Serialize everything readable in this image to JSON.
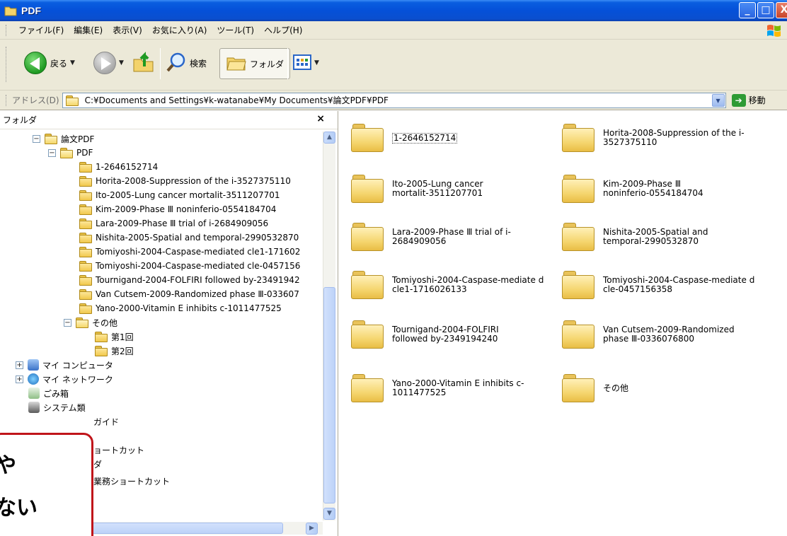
{
  "window": {
    "title": "PDF",
    "icon": "folder-icon"
  },
  "menu": [
    "ファイル(F)",
    "編集(E)",
    "表示(V)",
    "お気に入り(A)",
    "ツール(T)",
    "ヘルプ(H)"
  ],
  "toolbar": {
    "back_label": "戻る",
    "search_label": "検索",
    "folders_label": "フォルダ"
  },
  "address": {
    "label": "アドレス(D)",
    "path": "C:¥Documents and Settings¥k-watanabe¥My Documents¥論文PDF¥PDF",
    "go_label": "移動"
  },
  "folder_pane": {
    "title": "フォルダ",
    "close_glyph": "×",
    "tree": [
      {
        "label": "論文PDF",
        "toggle": "⊟"
      },
      {
        "label": "PDF",
        "toggle": "⊟"
      },
      {
        "label": "1-2646152714"
      },
      {
        "label": "Horita-2008-Suppression of the i-3527375110"
      },
      {
        "label": "Ito-2005-Lung cancer mortalit-3511207701"
      },
      {
        "label": "Kim-2009-Phase Ⅲ noninferio-0554184704"
      },
      {
        "label": "Lara-2009-Phase Ⅲ trial of i-2684909056"
      },
      {
        "label": "Nishita-2005-Spatial and temporal-2990532870"
      },
      {
        "label": "Tomiyoshi-2004-Caspase-mediated cle1-171602"
      },
      {
        "label": "Tomiyoshi-2004-Caspase-mediated cle-0457156"
      },
      {
        "label": "Tournigand-2004-FOLFIRI followed by-23491942"
      },
      {
        "label": "Van Cutsem-2009-Randomized phase Ⅲ-033607"
      },
      {
        "label": "Yano-2000-Vitamin E inhibits c-1011477525"
      },
      {
        "label": "その他",
        "toggle": "⊟"
      },
      {
        "label": "第1回"
      },
      {
        "label": "第2回"
      },
      {
        "label": "マイ コンピュータ",
        "toggle": "⊞"
      },
      {
        "label": "マイ ネットワーク",
        "toggle": "⊞"
      },
      {
        "label": "ごみ箱"
      },
      {
        "label": "システム類"
      },
      {
        "label": "ガイド"
      },
      {
        "label": "ョートカット"
      },
      {
        "label": "ダ"
      },
      {
        "label": "業務ショートカット"
      }
    ]
  },
  "content_items": [
    {
      "label": "1-2646152714",
      "selected": true
    },
    {
      "label": "Horita-2008-Suppression of the i-3527375110"
    },
    {
      "label": "Ito-2005-Lung cancer mortalit-3511207701"
    },
    {
      "label": "Kim-2009-Phase Ⅲ noninferio-0554184704"
    },
    {
      "label": "Lara-2009-Phase Ⅲ trial of i-2684909056"
    },
    {
      "label": "Nishita-2005-Spatial and temporal-2990532870"
    },
    {
      "label": "Tomiyoshi-2004-Caspase-mediate d cle1-1716026133"
    },
    {
      "label": "Tomiyoshi-2004-Caspase-mediate d cle-0457156358"
    },
    {
      "label": "Tournigand-2004-FOLFIRI followed by-2349194240"
    },
    {
      "label": "Van Cutsem-2009-Randomized phase Ⅲ-0336076800"
    },
    {
      "label": "Yano-2000-Vitamin E inhibits c-1011477525"
    },
    {
      "label": "その他"
    }
  ],
  "callout": {
    "line1": "や",
    "line2": "ない"
  },
  "colors": {
    "titlebar": "#0550d8",
    "chrome": "#ece9d8",
    "callout_border": "#c0141a"
  }
}
